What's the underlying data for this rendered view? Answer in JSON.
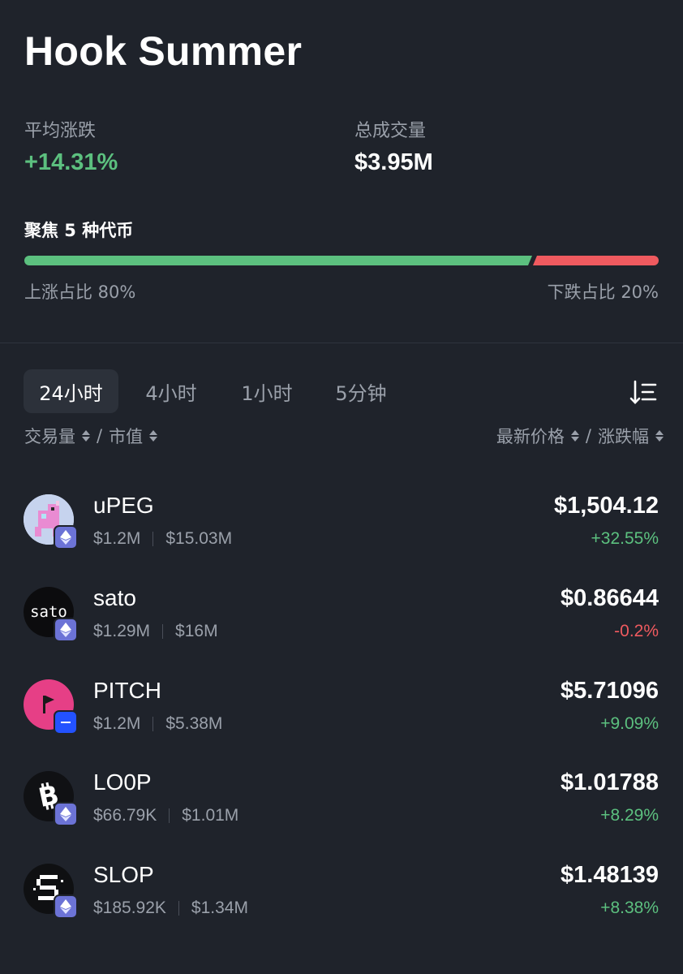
{
  "header": {
    "title": "Hook Summer"
  },
  "stats": {
    "avg_change_label": "平均涨跌",
    "avg_change_value": "+14.31%",
    "volume_label": "总成交量",
    "volume_value": "$3.95M"
  },
  "focus": {
    "label": "聚焦 5 种代币",
    "up_ratio_label": "上涨占比 80%",
    "down_ratio_label": "下跌占比 20%",
    "up_fraction": 0.8,
    "down_fraction": 0.2
  },
  "tabs": [
    {
      "label": "24小时",
      "active": true
    },
    {
      "label": "4小时",
      "active": false
    },
    {
      "label": "1小时",
      "active": false
    },
    {
      "label": "5分钟",
      "active": false
    }
  ],
  "sort_headers": {
    "volume": "交易量",
    "slash1": "/",
    "market_cap": "市值",
    "latest_price": "最新价格",
    "slash2": "/",
    "change": "涨跌幅"
  },
  "tokens": [
    {
      "name": "uPEG",
      "volume": "$1.2M",
      "market_cap": "$15.03M",
      "price": "$1,504.12",
      "change": "+32.55%",
      "direction": "up",
      "chain_icon": "ethereum-icon",
      "avatar": "pixel-unicorn"
    },
    {
      "name": "sato",
      "volume": "$1.29M",
      "market_cap": "$16M",
      "price": "$0.86644",
      "change": "-0.2%",
      "direction": "down",
      "chain_icon": "ethereum-icon",
      "avatar": "sato-text",
      "avatar_text": "sato"
    },
    {
      "name": "PITCH",
      "volume": "$1.2M",
      "market_cap": "$5.38M",
      "price": "$5.71096",
      "change": "+9.09%",
      "direction": "up",
      "chain_icon": "base-icon",
      "avatar": "pink-flag"
    },
    {
      "name": "LO0P",
      "volume": "$66.79K",
      "market_cap": "$1.01M",
      "price": "$1.01788",
      "change": "+8.29%",
      "direction": "up",
      "chain_icon": "ethereum-icon",
      "avatar": "bitcoin-glyph"
    },
    {
      "name": "SLOP",
      "volume": "$185.92K",
      "market_cap": "$1.34M",
      "price": "$1.48139",
      "change": "+8.38%",
      "direction": "up",
      "chain_icon": "ethereum-icon",
      "avatar": "pixel-s"
    }
  ],
  "colors": {
    "background": "#1f232b",
    "up": "#5cc07f",
    "down": "#ef5a5f",
    "muted": "#9aa0aa",
    "ethereum_badge": "#6c73d6",
    "base_badge": "#2352ff"
  }
}
